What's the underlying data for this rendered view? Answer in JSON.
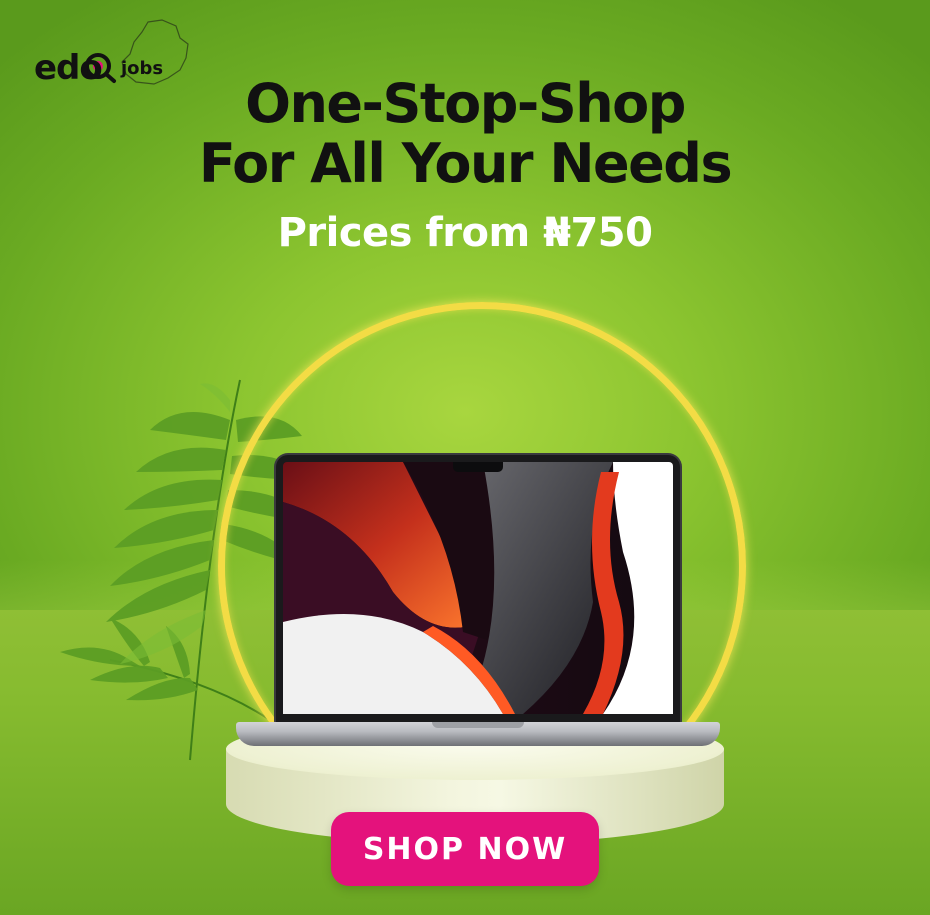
{
  "brand": {
    "logo_primary": "edo",
    "logo_secondary": "jobs",
    "logo_color": "#111111"
  },
  "headline": {
    "line1": "One-Stop-Shop",
    "line2": "For All Your Needs"
  },
  "subline": "Prices from ₦750",
  "cta": {
    "label": "SHOP NOW",
    "color": "#e4127c"
  },
  "colors": {
    "background": "#8cc530",
    "ring": "#f3dc45",
    "headline": "#111111",
    "subline": "#ffffff"
  },
  "product": {
    "icon": "laptop-icon"
  }
}
